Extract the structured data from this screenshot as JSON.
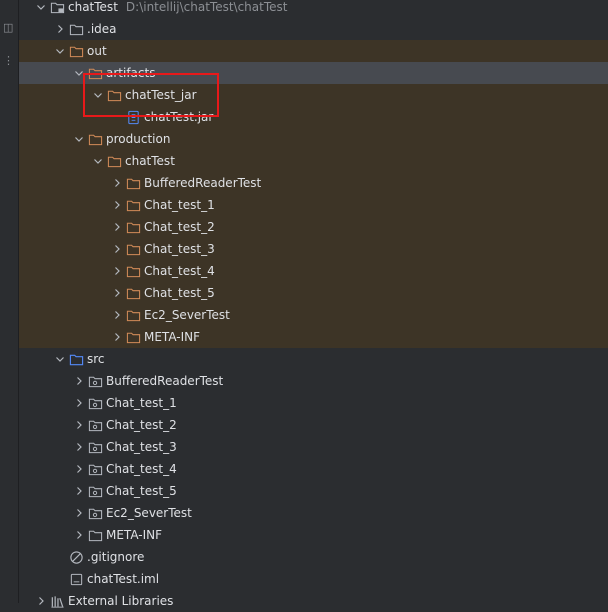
{
  "project": {
    "name": "chatTest",
    "path": "D:\\intellij\\chatTest\\chatTest"
  },
  "tree": [
    {
      "name": "root-item",
      "label": "chatTest",
      "depth": 0,
      "expanded": true,
      "icon": "module-folder-icon",
      "excluded": false,
      "selected": false,
      "path_label": "D:\\intellij\\chatTest\\chatTest"
    },
    {
      "name": "idea-folder",
      "label": ".idea",
      "depth": 1,
      "expanded": false,
      "icon": "folder-icon",
      "excluded": false
    },
    {
      "name": "out-folder",
      "label": "out",
      "depth": 1,
      "expanded": true,
      "icon": "excluded-folder-icon",
      "excluded": true
    },
    {
      "name": "artifacts-folder",
      "label": "artifacts",
      "depth": 2,
      "expanded": true,
      "icon": "excluded-folder-icon",
      "excluded": true,
      "selected": true
    },
    {
      "name": "chattest-jar-folder",
      "label": "chatTest_jar",
      "depth": 3,
      "expanded": true,
      "icon": "excluded-folder-icon",
      "excluded": true
    },
    {
      "name": "chattest-jar-file",
      "label": "chatTest.jar",
      "depth": 4,
      "expanded": null,
      "icon": "jar-file-icon",
      "excluded": true
    },
    {
      "name": "production-folder",
      "label": "production",
      "depth": 2,
      "expanded": true,
      "icon": "excluded-folder-icon",
      "excluded": true
    },
    {
      "name": "chattest-out-folder",
      "label": "chatTest",
      "depth": 3,
      "expanded": true,
      "icon": "excluded-folder-icon",
      "excluded": true
    },
    {
      "name": "out-bufferedreadertest",
      "label": "BufferedReaderTest",
      "depth": 4,
      "expanded": false,
      "icon": "excluded-folder-icon",
      "excluded": true
    },
    {
      "name": "out-chat-test-1",
      "label": "Chat_test_1",
      "depth": 4,
      "expanded": false,
      "icon": "excluded-folder-icon",
      "excluded": true
    },
    {
      "name": "out-chat-test-2",
      "label": "Chat_test_2",
      "depth": 4,
      "expanded": false,
      "icon": "excluded-folder-icon",
      "excluded": true
    },
    {
      "name": "out-chat-test-3",
      "label": "Chat_test_3",
      "depth": 4,
      "expanded": false,
      "icon": "excluded-folder-icon",
      "excluded": true
    },
    {
      "name": "out-chat-test-4",
      "label": "Chat_test_4",
      "depth": 4,
      "expanded": false,
      "icon": "excluded-folder-icon",
      "excluded": true
    },
    {
      "name": "out-chat-test-5",
      "label": "Chat_test_5",
      "depth": 4,
      "expanded": false,
      "icon": "excluded-folder-icon",
      "excluded": true
    },
    {
      "name": "out-ec2-severtest",
      "label": "Ec2_SeverTest",
      "depth": 4,
      "expanded": false,
      "icon": "excluded-folder-icon",
      "excluded": true
    },
    {
      "name": "out-meta-inf",
      "label": "META-INF",
      "depth": 4,
      "expanded": false,
      "icon": "excluded-folder-icon",
      "excluded": true
    },
    {
      "name": "src-folder",
      "label": "src",
      "depth": 1,
      "expanded": true,
      "icon": "source-folder-icon",
      "excluded": false
    },
    {
      "name": "src-bufferedreadertest",
      "label": "BufferedReaderTest",
      "depth": 2,
      "expanded": false,
      "icon": "package-icon",
      "excluded": false
    },
    {
      "name": "src-chat-test-1",
      "label": "Chat_test_1",
      "depth": 2,
      "expanded": false,
      "icon": "package-icon",
      "excluded": false
    },
    {
      "name": "src-chat-test-2",
      "label": "Chat_test_2",
      "depth": 2,
      "expanded": false,
      "icon": "package-icon",
      "excluded": false
    },
    {
      "name": "src-chat-test-3",
      "label": "Chat_test_3",
      "depth": 2,
      "expanded": false,
      "icon": "package-icon",
      "excluded": false
    },
    {
      "name": "src-chat-test-4",
      "label": "Chat_test_4",
      "depth": 2,
      "expanded": false,
      "icon": "package-icon",
      "excluded": false
    },
    {
      "name": "src-chat-test-5",
      "label": "Chat_test_5",
      "depth": 2,
      "expanded": false,
      "icon": "package-icon",
      "excluded": false
    },
    {
      "name": "src-ec2-severtest",
      "label": "Ec2_SeverTest",
      "depth": 2,
      "expanded": false,
      "icon": "package-icon",
      "excluded": false
    },
    {
      "name": "src-meta-inf",
      "label": "META-INF",
      "depth": 2,
      "expanded": false,
      "icon": "folder-icon",
      "excluded": false
    },
    {
      "name": "gitignore-file",
      "label": ".gitignore",
      "depth": 1,
      "expanded": null,
      "icon": "ignored-file-icon",
      "excluded": false
    },
    {
      "name": "chattest-iml-file",
      "label": "chatTest.iml",
      "depth": 1,
      "expanded": null,
      "icon": "iml-file-icon",
      "excluded": false
    },
    {
      "name": "external-libraries",
      "label": "External Libraries",
      "depth": 0,
      "expanded": false,
      "icon": "library-icon",
      "excluded": false
    }
  ],
  "colors": {
    "background": "#2b2d30",
    "excluded_background": "#3d3426",
    "excluded_folder": "#d28b58",
    "folder": "#b4b8bf",
    "source_folder": "#548af7",
    "highlight_border": "#e8191a"
  }
}
